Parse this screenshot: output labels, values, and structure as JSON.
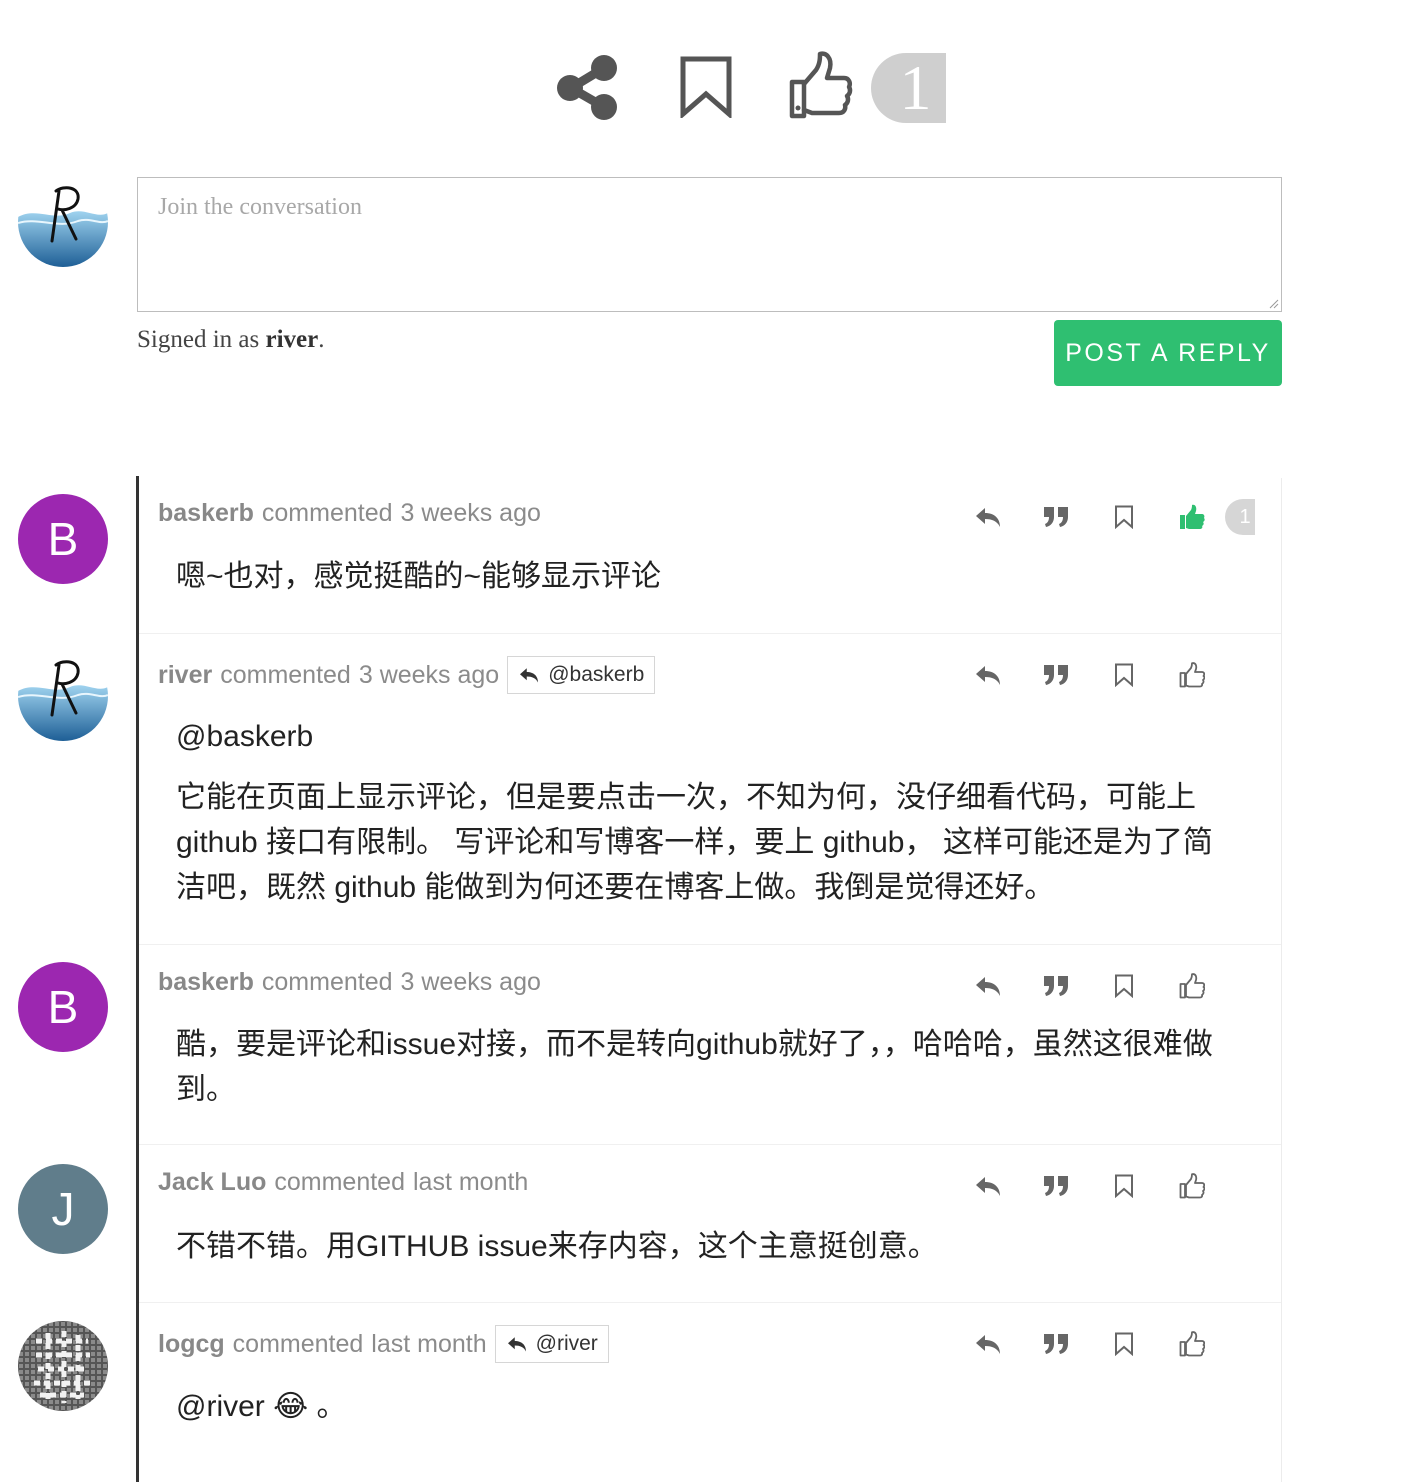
{
  "post_actions": {
    "share_icon": "share-icon",
    "bookmark_icon": "bookmark-icon",
    "like_icon": "thumbs-up-icon",
    "like_count": "1"
  },
  "composer": {
    "placeholder": "Join the conversation",
    "signed_in_prefix": "Signed in as ",
    "username": "river",
    "signed_in_suffix": ".",
    "post_button_label": "POST A REPLY",
    "button_color": "#2fbf71"
  },
  "comments": [
    {
      "author": "baskerb",
      "verb": "commented",
      "time": "3 weeks ago",
      "avatar_letter": "B",
      "avatar_color": "#9c27b0",
      "liked": true,
      "like_count": "1",
      "body": [
        "嗯~也对，感觉挺酷的~能够显示评论"
      ]
    },
    {
      "author": "river",
      "verb": "commented",
      "time": "3 weeks ago",
      "reply_to": "@baskerb",
      "liked": false,
      "body": [
        "@baskerb",
        "它能在页面上显示评论，但是要点击一次，不知为何，没仔细看代码，可能上 github 接口有限制。 写评论和写博客一样，要上 github， 这样可能还是为了简洁吧，既然 github 能做到为何还要在博客上做。我倒是觉得还好。"
      ]
    },
    {
      "author": "baskerb",
      "verb": "commented",
      "time": "3 weeks ago",
      "avatar_letter": "B",
      "avatar_color": "#9c27b0",
      "liked": false,
      "body": [
        "酷，要是评论和issue对接，而不是转向github就好了，，哈哈哈，虽然这很难做到。"
      ]
    },
    {
      "author": "Jack Luo",
      "verb": "commented",
      "time": "last month",
      "avatar_letter": "J",
      "avatar_color": "#607d8b",
      "liked": false,
      "body": [
        "不错不错。用GITHUB issue来存内容，这个主意挺创意。"
      ]
    },
    {
      "author": "logcg",
      "verb": "commented",
      "time": "last month",
      "reply_to": "@river",
      "liked": false,
      "body": [
        "@river 😂 。"
      ]
    }
  ],
  "action_icons": [
    "reply-icon",
    "quote-icon",
    "bookmark-icon",
    "thumbs-up-icon"
  ],
  "colors": {
    "accent_green": "#2fbf71",
    "icon_gray": "#666666",
    "count_bg": "#cfcfcf"
  }
}
